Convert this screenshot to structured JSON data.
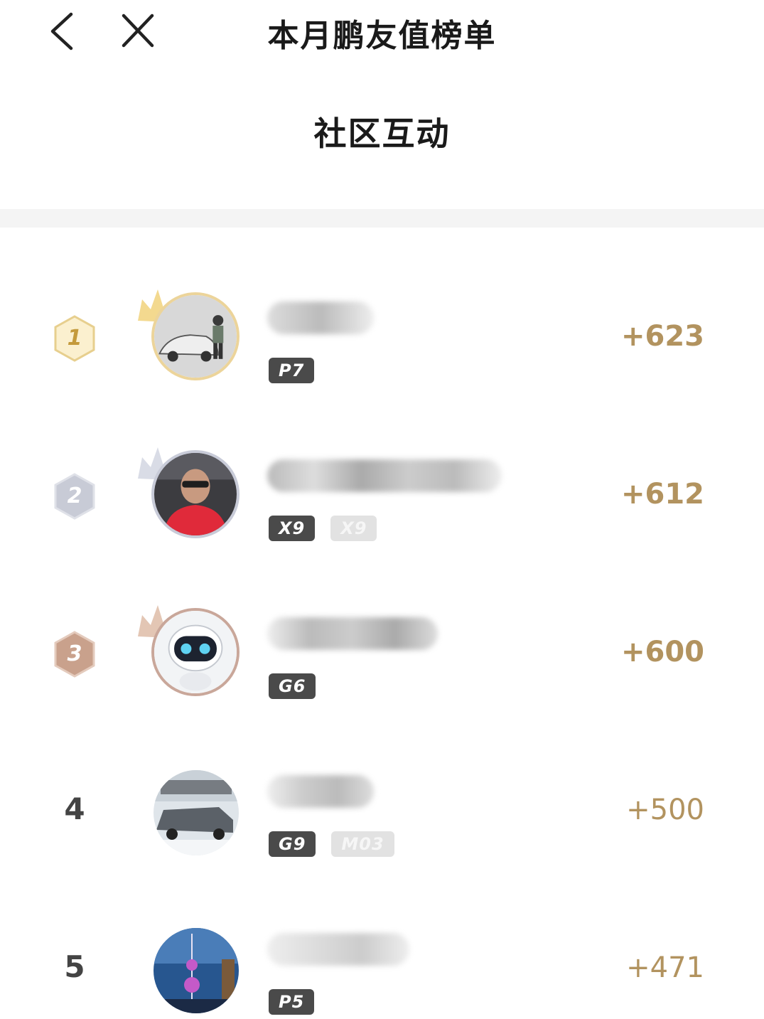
{
  "header": {
    "title": "本月鹏友值榜单"
  },
  "section": {
    "title": "社区互动"
  },
  "colors": {
    "accent_gold": "#b2935f",
    "tag_dark": "#4a4a4a",
    "tag_light": "#e2e2e2"
  },
  "rows": [
    {
      "rank": "1",
      "name_visible": "",
      "tags": [
        "P7"
      ],
      "tag_styles": [
        "dark"
      ],
      "score": "+623",
      "medal": "gold",
      "avatar": "car-cartoon"
    },
    {
      "rank": "2",
      "name_visible": "",
      "tags": [
        "X9",
        "X9"
      ],
      "tag_styles": [
        "dark",
        "light"
      ],
      "score": "+612",
      "medal": "silver",
      "avatar": "person-photo"
    },
    {
      "rank": "3",
      "name_visible": "",
      "tags": [
        "G6"
      ],
      "tag_styles": [
        "dark"
      ],
      "score": "+600",
      "medal": "bronze",
      "avatar": "robot"
    },
    {
      "rank": "4",
      "name_visible": "",
      "tags": [
        "G9",
        "M03"
      ],
      "tag_styles": [
        "dark",
        "light"
      ],
      "score": "+500",
      "medal": "none",
      "avatar": "car-photo"
    },
    {
      "rank": "5",
      "name_visible": "",
      "tags": [
        "P5"
      ],
      "tag_styles": [
        "dark"
      ],
      "score": "+471",
      "medal": "none",
      "avatar": "city-tower"
    }
  ]
}
